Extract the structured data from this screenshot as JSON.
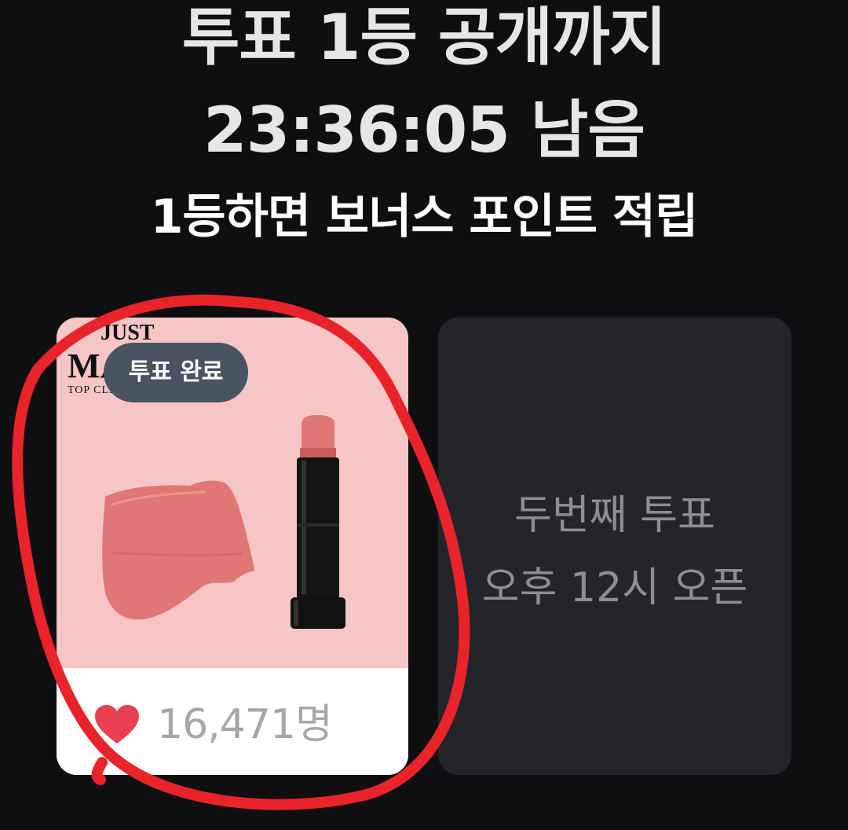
{
  "header": {
    "line1": "투표 1등 공개까지",
    "line2": "23:36:05 남음",
    "line3": "1등하면 보너스 포인트 적립"
  },
  "voted_card": {
    "brand_line1": "JUST",
    "brand_line2": "MA",
    "brand_line3": "TOP CLASS",
    "badge": "투표 완료",
    "icon": "heart-icon",
    "count": "16,471명",
    "swatch_color": "#e07774",
    "heart_color": "#e8404f"
  },
  "next_card": {
    "line1": "두번째 투표",
    "line2": "오후 12시 오픈"
  },
  "annotation": {
    "color": "#e8242a"
  }
}
